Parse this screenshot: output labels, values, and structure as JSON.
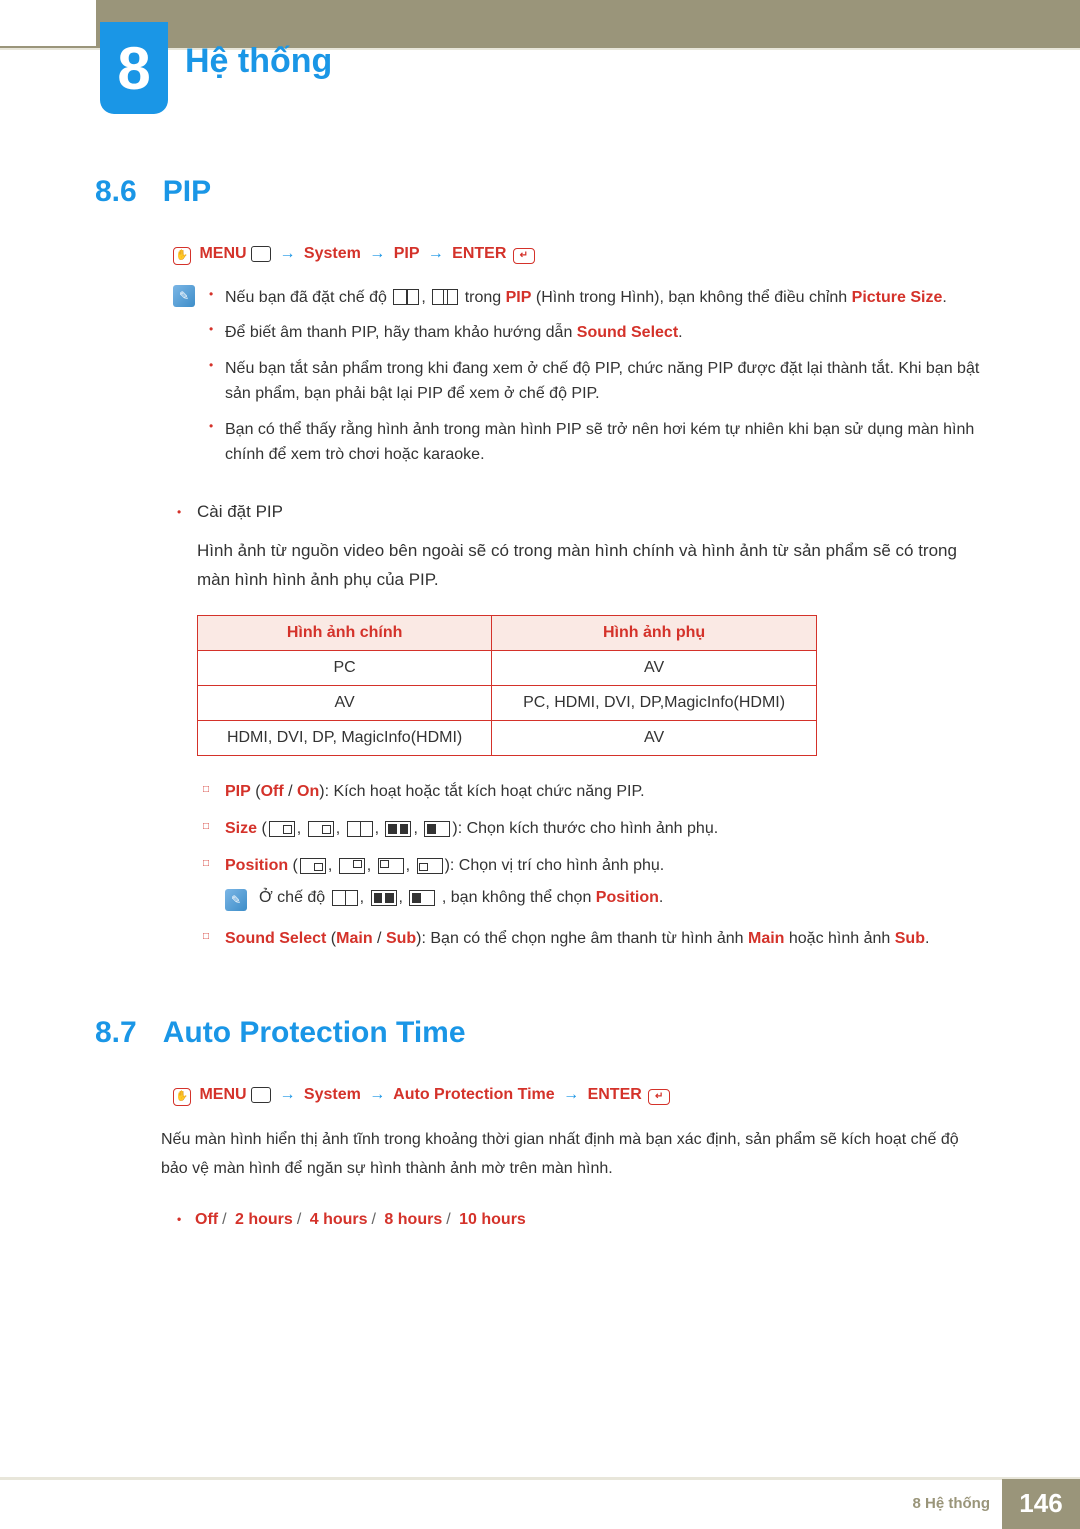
{
  "chapter": {
    "number": "8",
    "title": "Hệ thống"
  },
  "sections": {
    "pip": {
      "num": "8.6",
      "title": "PIP",
      "menu": {
        "menu": "MENU",
        "system": "System",
        "item": "PIP",
        "enter": "ENTER"
      },
      "note1_a": "Nếu bạn đã đặt chế độ ",
      "note1_b": " trong ",
      "note1_pip": "PIP",
      "note1_c": " (Hình trong Hình), bạn không thể điều chỉnh ",
      "note1_ps": "Picture Size",
      "note2_a": "Để biết âm thanh PIP, hãy tham khảo hướng dẫn ",
      "note2_ss": "Sound Select",
      "note3": "Nếu bạn tắt sản phẩm trong khi đang xem ở chế độ PIP, chức năng PIP được đặt lại thành tắt. Khi bạn bật sản phẩm, bạn phải bật lại PIP để xem ở chế độ PIP.",
      "note4": "Bạn có thể thấy rằng hình ảnh trong màn hình PIP sẽ trở nên hơi kém tự nhiên khi bạn sử dụng màn hình chính để xem trò chơi hoặc karaoke.",
      "bullet1": "Cài đặt PIP",
      "para1": "Hình ảnh từ nguồn video bên ngoài sẽ có trong màn hình chính và hình ảnh từ sản phẩm sẽ có trong màn hình hình ảnh phụ của PIP.",
      "table": {
        "h1": "Hình ảnh chính",
        "h2": "Hình ảnh phụ",
        "rows": [
          {
            "c1": "PC",
            "c2": "AV"
          },
          {
            "c1": "AV",
            "c2": "PC, HDMI, DVI, DP,MagicInfo(HDMI)"
          },
          {
            "c1": "HDMI, DVI, DP, MagicInfo(HDMI)",
            "c2": "AV"
          }
        ]
      },
      "sub1": {
        "pip": "PIP",
        "off": "Off",
        "on": "On",
        "txt": ": Kích hoạt hoặc tắt kích hoạt chức năng PIP."
      },
      "sub2": {
        "size": "Size",
        "txt": ": Chọn kích thước cho hình ảnh phụ."
      },
      "sub3": {
        "pos": "Position",
        "txt": ": Chọn vị trí cho hình ảnh phụ."
      },
      "note5_a": "Ở chế độ ",
      "note5_b": ", bạn không thể chọn ",
      "note5_pos": "Position",
      "sub4": {
        "ss": "Sound Select",
        "main": "Main",
        "sub": "Sub",
        "txt_a": ": Bạn có thể chọn nghe âm thanh từ hình ảnh ",
        "txt_b": " hoặc hình ảnh ",
        "main2": "Main",
        "sub2": "Sub"
      }
    },
    "apt": {
      "num": "8.7",
      "title": "Auto Protection Time",
      "menu": {
        "menu": "MENU",
        "system": "System",
        "item": "Auto Protection Time",
        "enter": "ENTER"
      },
      "body": "Nếu màn hình hiển thị ảnh tĩnh trong khoảng thời gian nhất định mà bạn xác định, sản phẩm sẽ kích hoạt chế độ bảo vệ màn hình để ngăn sự hình thành ảnh mờ trên màn hình.",
      "options": [
        "Off",
        "2 hours",
        "4 hours",
        "8 hours",
        "10 hours"
      ]
    }
  },
  "footer": {
    "label": "8 Hệ thống",
    "page": "146"
  }
}
